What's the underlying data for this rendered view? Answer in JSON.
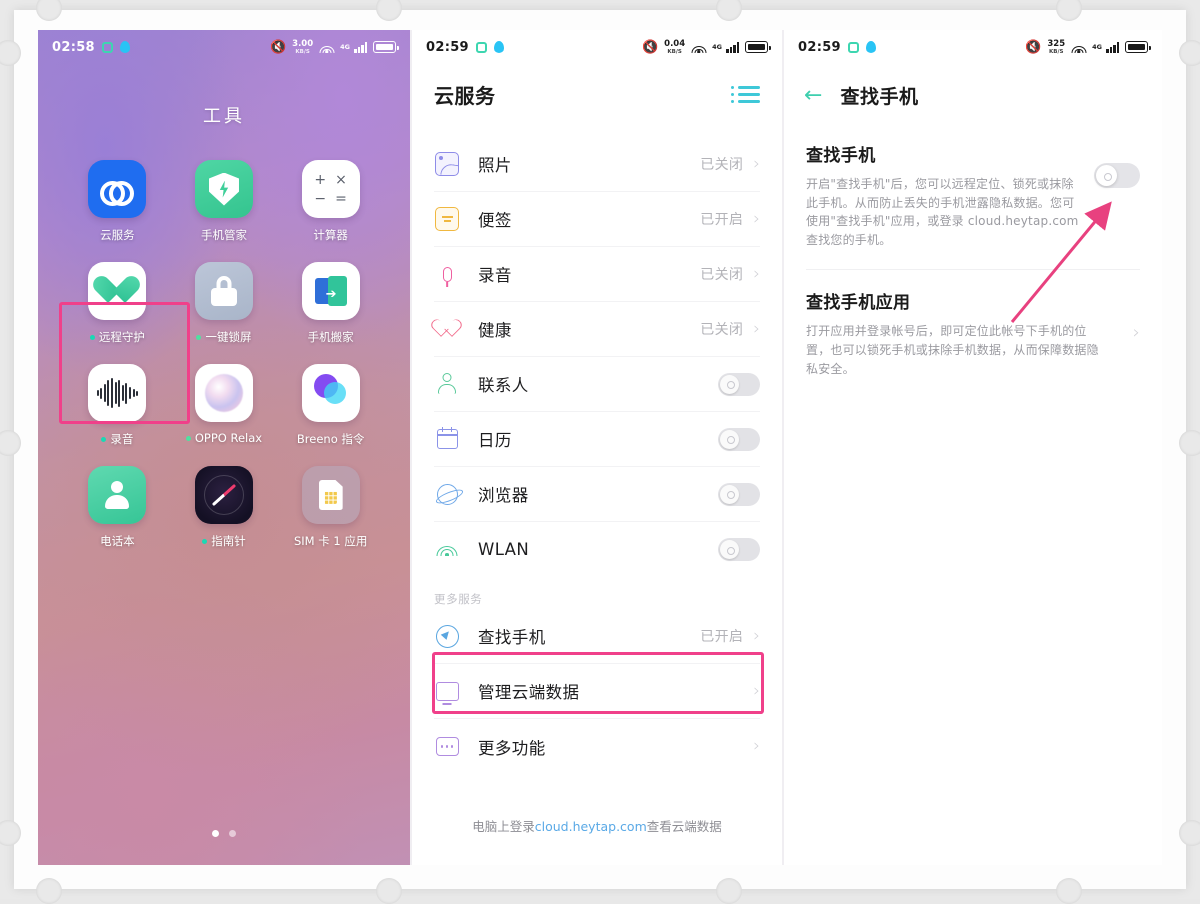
{
  "screen1": {
    "status": {
      "time": "02:58",
      "net_speed": "3.00",
      "net_unit": "KB/S",
      "signal": "4G"
    },
    "folder_title": "工具",
    "apps": [
      {
        "label": "云服务",
        "icon": "cloud-service-icon",
        "badge": false
      },
      {
        "label": "手机管家",
        "icon": "phone-manager-shield-icon",
        "badge": false
      },
      {
        "label": "计算器",
        "icon": "calculator-icon",
        "badge": false
      },
      {
        "label": "远程守护",
        "icon": "remote-guard-heart-icon",
        "badge": true
      },
      {
        "label": "一键锁屏",
        "icon": "lock-screen-padlock-icon",
        "badge": true
      },
      {
        "label": "手机搬家",
        "icon": "phone-clone-icon",
        "badge": false
      },
      {
        "label": "录音",
        "icon": "recorder-waveform-icon",
        "badge": true
      },
      {
        "label": "OPPO Relax",
        "icon": "oppo-relax-orb-icon",
        "badge": true
      },
      {
        "label": "Breeno 指令",
        "icon": "breeno-circles-icon",
        "badge": false
      },
      {
        "label": "电话本",
        "icon": "contacts-person-icon",
        "badge": false
      },
      {
        "label": "指南针",
        "icon": "compass-needle-icon",
        "badge": true
      },
      {
        "label": "SIM 卡 1 应用",
        "icon": "sim-card-icon",
        "badge": false
      }
    ],
    "page_dots": {
      "count": 2,
      "active": 1
    }
  },
  "screen2": {
    "status": {
      "time": "02:59",
      "net_speed": "0.04",
      "net_unit": "KB/S",
      "signal": "4G"
    },
    "title": "云服务",
    "menu_icon": "list-menu-icon",
    "rows": [
      {
        "name": "照片",
        "icon": "photo-icon",
        "value": "已关闭",
        "control": "chevron"
      },
      {
        "name": "便签",
        "icon": "note-icon",
        "value": "已开启",
        "control": "chevron"
      },
      {
        "name": "录音",
        "icon": "mic-icon",
        "value": "已关闭",
        "control": "chevron"
      },
      {
        "name": "健康",
        "icon": "health-heart-icon",
        "value": "已关闭",
        "control": "chevron"
      },
      {
        "name": "联系人",
        "icon": "contacts-icon",
        "value": "",
        "control": "toggle",
        "toggle_on": false
      },
      {
        "name": "日历",
        "icon": "calendar-icon",
        "value": "",
        "control": "toggle",
        "toggle_on": false
      },
      {
        "name": "浏览器",
        "icon": "browser-icon",
        "value": "",
        "control": "toggle",
        "toggle_on": false
      },
      {
        "name": "WLAN",
        "icon": "wifi-icon",
        "value": "",
        "control": "toggle",
        "toggle_on": false
      }
    ],
    "more_label": "更多服务",
    "more_rows": [
      {
        "name": "查找手机",
        "icon": "find-phone-icon",
        "value": "已开启",
        "control": "chevron",
        "highlighted": true
      },
      {
        "name": "管理云端数据",
        "icon": "monitor-icon",
        "value": "",
        "control": "chevron"
      },
      {
        "name": "更多功能",
        "icon": "more-dots-icon",
        "value": "",
        "control": "chevron"
      }
    ],
    "footer": {
      "pre": "电脑上登录",
      "link": "cloud.heytap.com",
      "post": "查看云端数据"
    }
  },
  "screen3": {
    "status": {
      "time": "02:59",
      "net_speed": "325",
      "net_unit": "KB/S",
      "signal": "4G"
    },
    "back_icon": "back-arrow-icon",
    "title": "查找手机",
    "section1": {
      "heading": "查找手机",
      "body": "开启\"查找手机\"后，您可以远程定位、锁死或抹除此手机。从而防止丢失的手机泄露隐私数据。您可使用\"查找手机\"应用，或登录 cloud.heytap.com 查找您的手机。",
      "toggle_on": false
    },
    "section2": {
      "heading": "查找手机应用",
      "body": "打开应用并登录帐号后，即可定位此帐号下手机的位置，也可以锁死手机或抹除手机数据，从而保障数据隐私安全。"
    }
  },
  "annotations": {
    "highlight_color": "#f0408a",
    "arrow_color": "#e8417f",
    "boxes": [
      "云服务 app icon",
      "查找手机 list row"
    ],
    "arrow_points_to": "查找手机 toggle switch"
  }
}
